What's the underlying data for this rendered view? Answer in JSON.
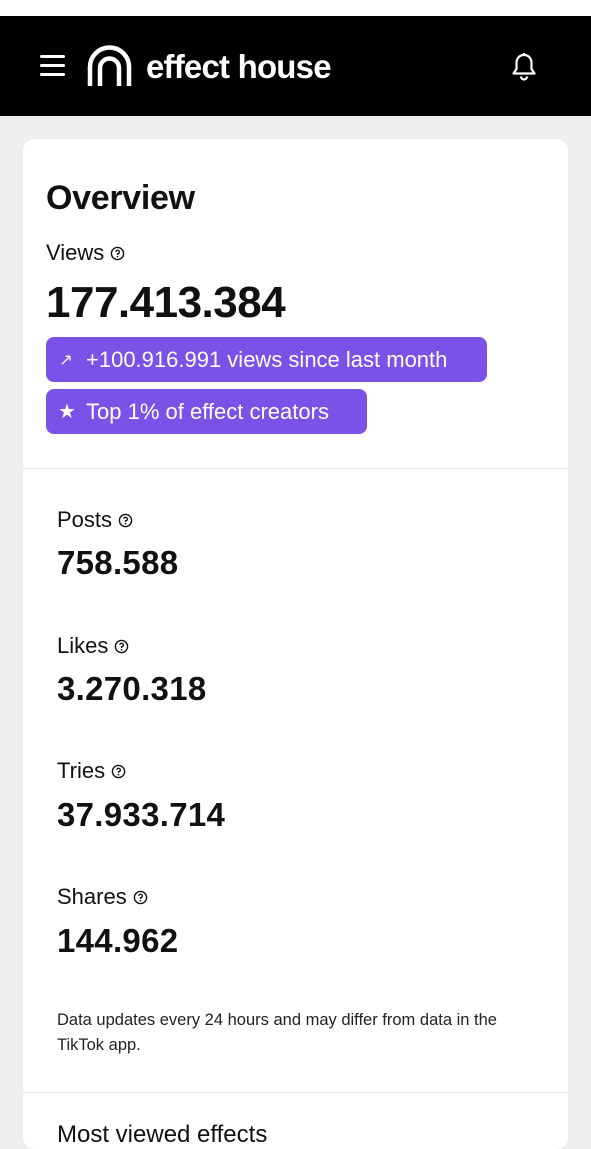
{
  "header": {
    "brand_name": "effect house",
    "icons": {
      "menu": "hamburger-menu-icon",
      "logo": "effect-house-logo-icon",
      "notifications": "bell-icon"
    },
    "background": "#000000"
  },
  "overview": {
    "title": "Overview",
    "views": {
      "label": "Views",
      "value": "177.413.384"
    },
    "badges": [
      {
        "icon": "↗",
        "icon_name": "trend-up-arrow-icon",
        "text": "+100.916.991 views since last month"
      },
      {
        "icon": "★",
        "icon_name": "star-icon",
        "text": "Top 1% of effect creators"
      }
    ],
    "badge_color": "#7b52e8"
  },
  "stats": [
    {
      "label": "Posts",
      "value": "758.588"
    },
    {
      "label": "Likes",
      "value": "3.270.318"
    },
    {
      "label": "Tries",
      "value": "37.933.714"
    },
    {
      "label": "Shares",
      "value": "144.962"
    }
  ],
  "disclaimer": "Data updates every 24 hours and may differ from data in the TikTok app.",
  "most_viewed": {
    "title": "Most viewed effects"
  }
}
